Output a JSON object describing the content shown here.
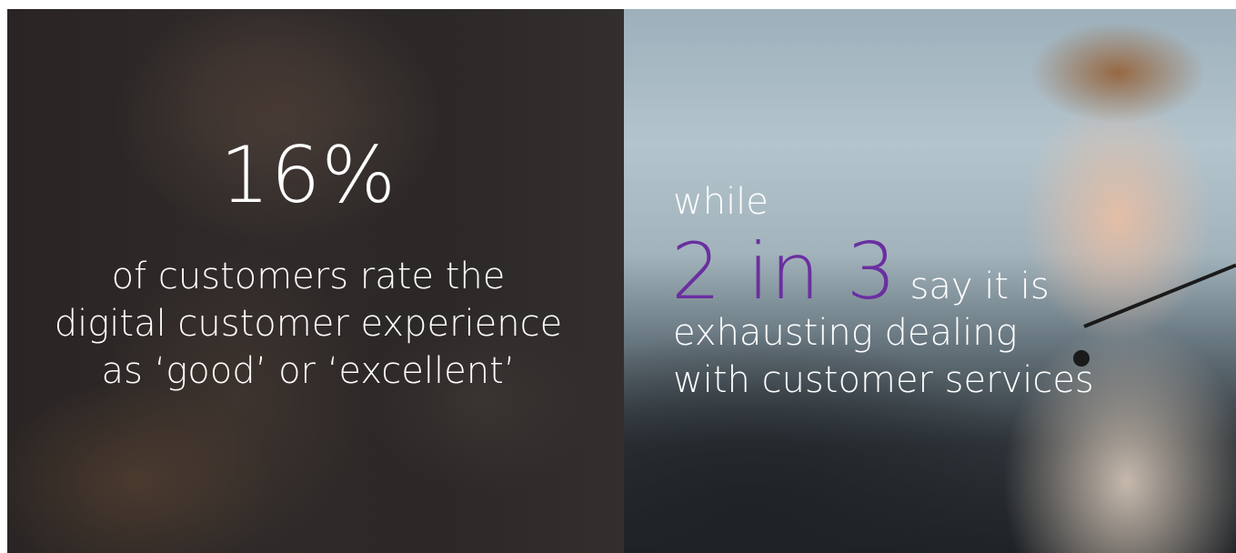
{
  "left": {
    "stat": "16%",
    "caption_line1": "of customers rate the",
    "caption_line2": "digital customer experience",
    "caption_line3": "as ‘good’ or ‘excellent’"
  },
  "right": {
    "lead": "while",
    "ratio": "2 in 3",
    "ratio_tail": "say it is",
    "caption_line1": "exhausting dealing",
    "caption_line2": "with customer services"
  },
  "colors": {
    "accent": "#6a2fa0",
    "text": "#ffffff",
    "left_panel": "#2c2827"
  }
}
